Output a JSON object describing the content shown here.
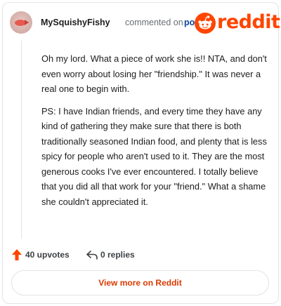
{
  "comment": {
    "author": "MySquishyFishy",
    "action_text": "commented on",
    "post_link_text": "post",
    "paragraphs": [
      "Oh my lord. What a piece of work she is!! NTA, and don't even worry about losing her \"friendship.\" It was never a real one to begin with.",
      "PS: I have Indian friends, and every time they have any kind of gathering they make sure that there is both traditionally seasoned Indian food, and plenty that is less spicy for people who aren't used to it. They are the most generous cooks I've ever encountered. I totally believe that you did all that work for your \"friend.\" What a shame she couldn't appreciated it."
    ]
  },
  "brand": {
    "logo_text": "reddit",
    "accent_color": "#ff4500"
  },
  "stats": {
    "upvotes": "40 upvotes",
    "replies": "0 replies"
  },
  "footer": {
    "view_more_label": "View more on Reddit"
  },
  "icons": [
    "avatar-fish",
    "reddit-snoo-icon",
    "upvote-arrow-icon",
    "reply-arrow-icon"
  ]
}
